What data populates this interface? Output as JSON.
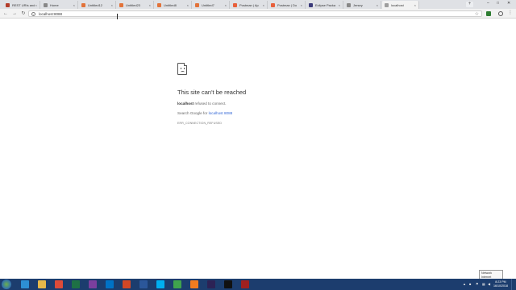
{
  "tabs": [
    {
      "title": "REST URIs and",
      "color": "#b33c2a",
      "active": false
    },
    {
      "title": "Home",
      "color": "#888888",
      "active": false
    },
    {
      "title": "Untitled12",
      "color": "#e2733a",
      "active": false
    },
    {
      "title": "Untitled23",
      "color": "#e2733a",
      "active": false
    },
    {
      "title": "Untitled8",
      "color": "#e2733a",
      "active": false
    },
    {
      "title": "Untitled7",
      "color": "#e2733a",
      "active": false
    },
    {
      "title": "Postman | Ap",
      "color": "#e8603c",
      "active": false
    },
    {
      "title": "Postman | Do",
      "color": "#e8603c",
      "active": false
    },
    {
      "title": "Eclipse Packa",
      "color": "#3b3b7a",
      "active": false
    },
    {
      "title": "Jersey",
      "color": "#888888",
      "active": false
    },
    {
      "title": "localhost",
      "color": "#9e9e9e",
      "active": true
    }
  ],
  "toolbar": {
    "back_icon": "←",
    "forward_icon": "→",
    "reload_icon": "↻",
    "info_icon": "i",
    "url": "localhost:8088",
    "star_icon": "☆"
  },
  "error": {
    "title": "This site can't be reached",
    "host": "localhost",
    "refused_text": "refused to connect.",
    "search_prefix": "Search Google for",
    "search_link": "localhost 8088",
    "code": "ERR_CONNECTION_REFUSED"
  },
  "network_tooltip": {
    "line1": "Network",
    "line2": "Internet access"
  },
  "taskbar": {
    "time": "8:23 PM",
    "date": "16/10/2018",
    "apps": [
      {
        "name": "ie-icon",
        "color": "#2d8fd5"
      },
      {
        "name": "explorer-icon",
        "color": "#e6b84a"
      },
      {
        "name": "chrome-icon",
        "color": "#dd4b39"
      },
      {
        "name": "excel-icon",
        "color": "#1e7145"
      },
      {
        "name": "onenote-icon",
        "color": "#7b3f9e"
      },
      {
        "name": "outlook-icon",
        "color": "#0072c6"
      },
      {
        "name": "powerpoint-icon",
        "color": "#d24726"
      },
      {
        "name": "word-icon",
        "color": "#2b579a"
      },
      {
        "name": "skype-icon",
        "color": "#00aff0"
      },
      {
        "name": "app-green-icon",
        "color": "#3fa34d"
      },
      {
        "name": "app-orange-icon",
        "color": "#f07c1f"
      },
      {
        "name": "eclipse-icon",
        "color": "#2c2255"
      },
      {
        "name": "terminal-icon",
        "color": "#111111"
      },
      {
        "name": "app-red-icon",
        "color": "#a02020"
      }
    ]
  }
}
